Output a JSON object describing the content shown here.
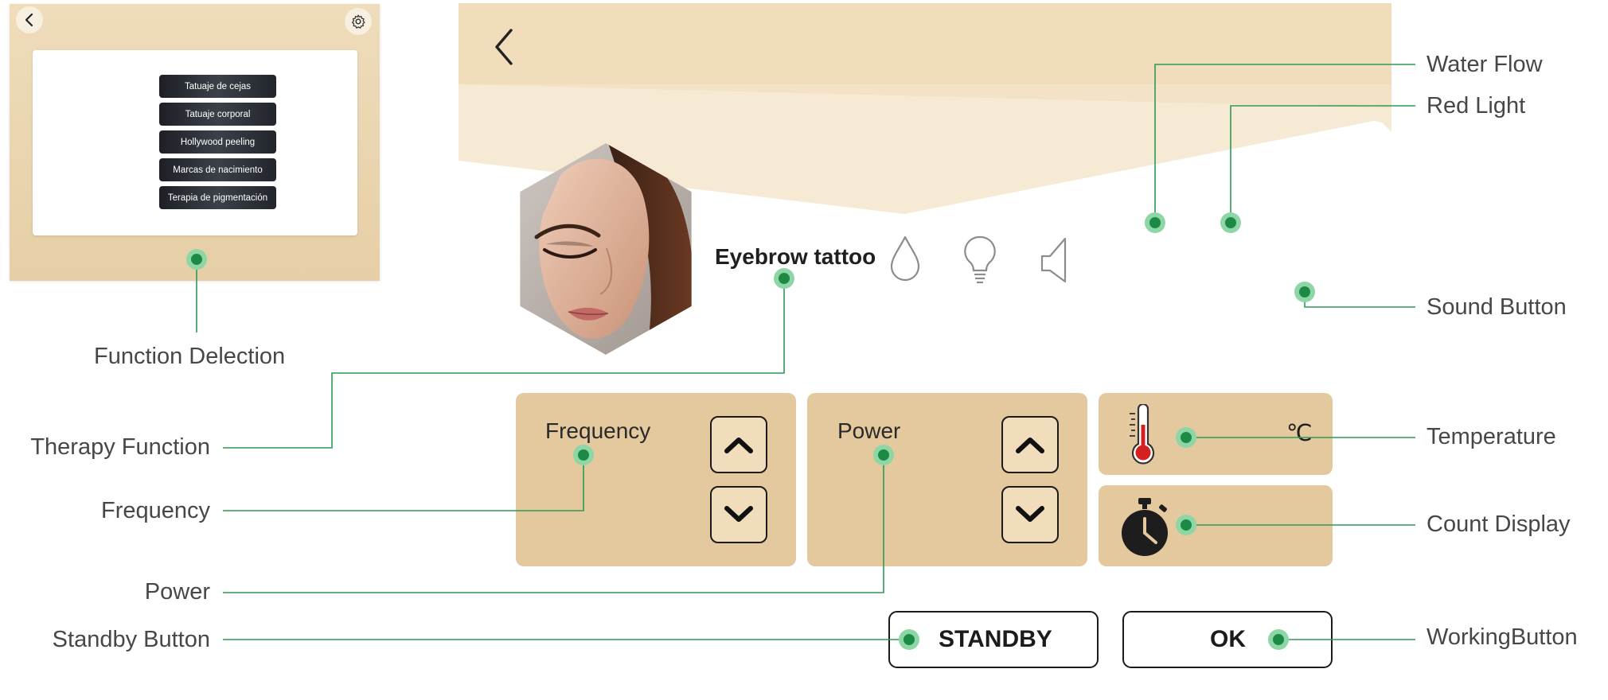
{
  "preview": {
    "menu_items": [
      "Tatuaje de cejas",
      "Tatuaje corporal",
      "Hollywood peeling",
      "Marcas de nacimiento",
      "Terapia de pigmentación"
    ]
  },
  "screen": {
    "therapy_title": "Eyebrow tattoo",
    "frequency_label": "Frequency",
    "power_label": "Power",
    "temperature_unit": "℃",
    "standby_label": "STANDBY",
    "ok_label": "OK",
    "colors": {
      "beige": "#f1ddbc",
      "panel": "#e3c99d",
      "thermo_red": "#d42020"
    }
  },
  "callouts": {
    "function_selection": "Function Delection",
    "therapy_function": "Therapy Function",
    "frequency": "Frequency",
    "power": "Power",
    "standby_button": "Standby Button",
    "water_flow": "Water Flow",
    "red_light": "Red Light",
    "sound_button": "Sound Button",
    "temperature": "Temperature",
    "count_display": "Count Display",
    "working_button": "WorkingButton",
    "marker_color": "#1c8a45",
    "leader_color": "#2e9a57"
  }
}
